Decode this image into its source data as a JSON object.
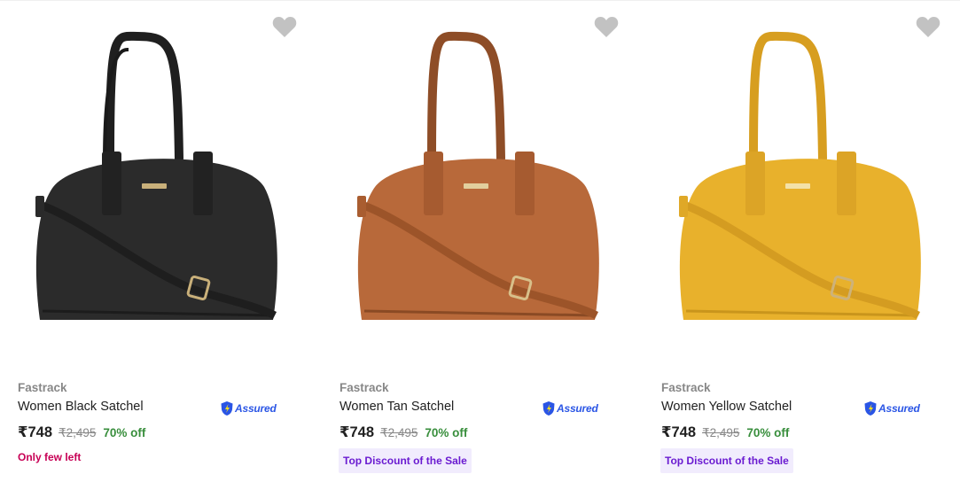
{
  "products": [
    {
      "brand": "Fastrack",
      "title": "Women Black Satchel",
      "assured_label": "Assured",
      "price": "₹748",
      "mrp": "₹2,495",
      "discount": "70% off",
      "note": "Only few left",
      "promo": "",
      "color": "#2b2b2b",
      "logo_text": "fastrack"
    },
    {
      "brand": "Fastrack",
      "title": "Women Tan Satchel",
      "assured_label": "Assured",
      "price": "₹748",
      "mrp": "₹2,495",
      "discount": "70% off",
      "note": "",
      "promo": "Top Discount of the Sale",
      "color": "#b8693a",
      "logo_text": "fastrack"
    },
    {
      "brand": "Fastrack",
      "title": "Women Yellow Satchel",
      "assured_label": "Assured",
      "price": "₹748",
      "mrp": "₹2,495",
      "discount": "70% off",
      "note": "",
      "promo": "Top Discount of the Sale",
      "color": "#e8b12c",
      "logo_text": "fastrack"
    }
  ]
}
